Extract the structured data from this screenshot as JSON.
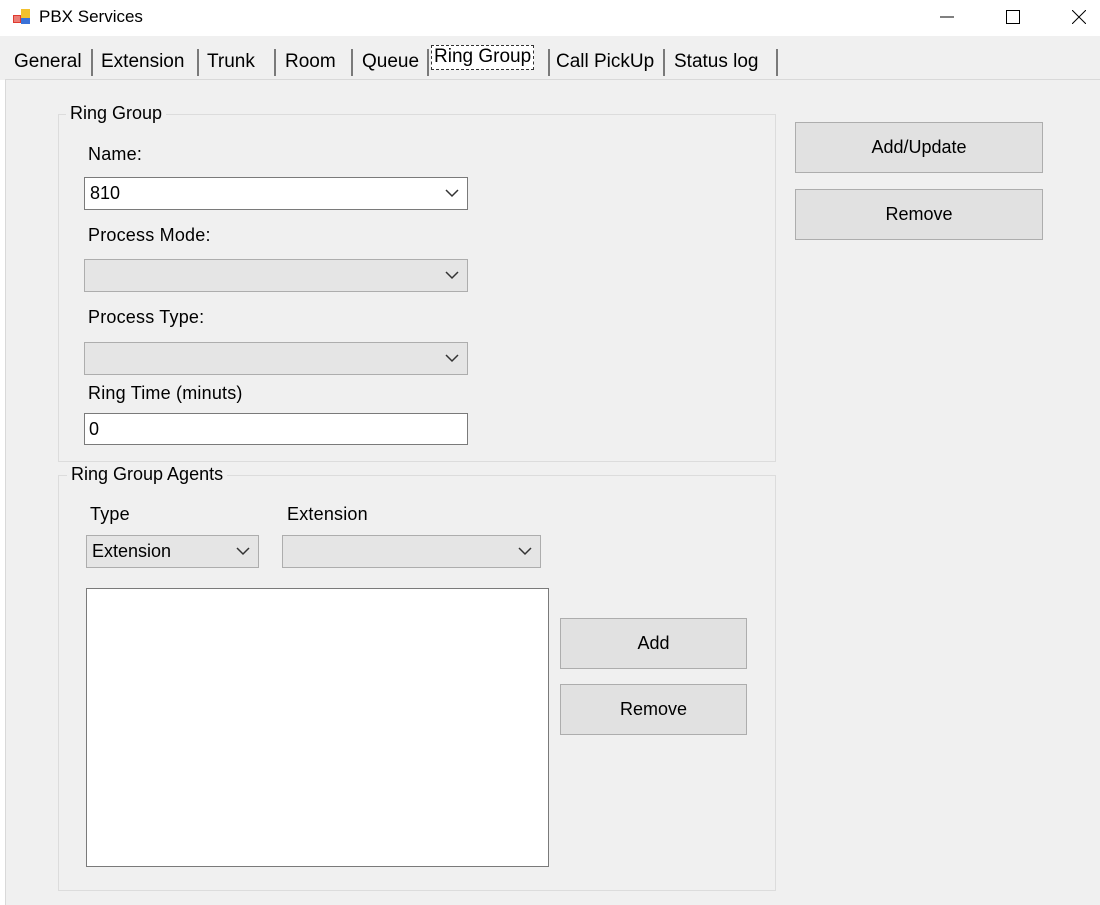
{
  "window": {
    "title": "PBX Services",
    "icon": "app-icon",
    "controls": [
      "minimize-icon",
      "maximize-icon",
      "close-icon"
    ]
  },
  "tabs": [
    {
      "label": "General"
    },
    {
      "label": "Extension"
    },
    {
      "label": "Trunk"
    },
    {
      "label": "Room"
    },
    {
      "label": "Queue"
    },
    {
      "label": "Ring Group",
      "selected": true
    },
    {
      "label": "Call PickUp"
    },
    {
      "label": "Status log"
    }
  ],
  "ring_group": {
    "legend": "Ring Group",
    "name_label": "Name:",
    "name_value": "810",
    "process_mode_label": "Process Mode:",
    "process_mode_value": "",
    "process_type_label": "Process Type:",
    "process_type_value": "",
    "ring_time_label": "Ring Time (minuts)",
    "ring_time_value": "0"
  },
  "actions": {
    "add_update": "Add/Update",
    "remove": "Remove"
  },
  "agents": {
    "legend": "Ring Group Agents",
    "type_label": "Type",
    "type_value": "Extension",
    "extension_label": "Extension",
    "extension_value": "",
    "add": "Add",
    "remove": "Remove",
    "items": []
  },
  "colors": {
    "panel": "#f0f0f0",
    "button": "#e1e1e1",
    "border": "#adadad"
  }
}
